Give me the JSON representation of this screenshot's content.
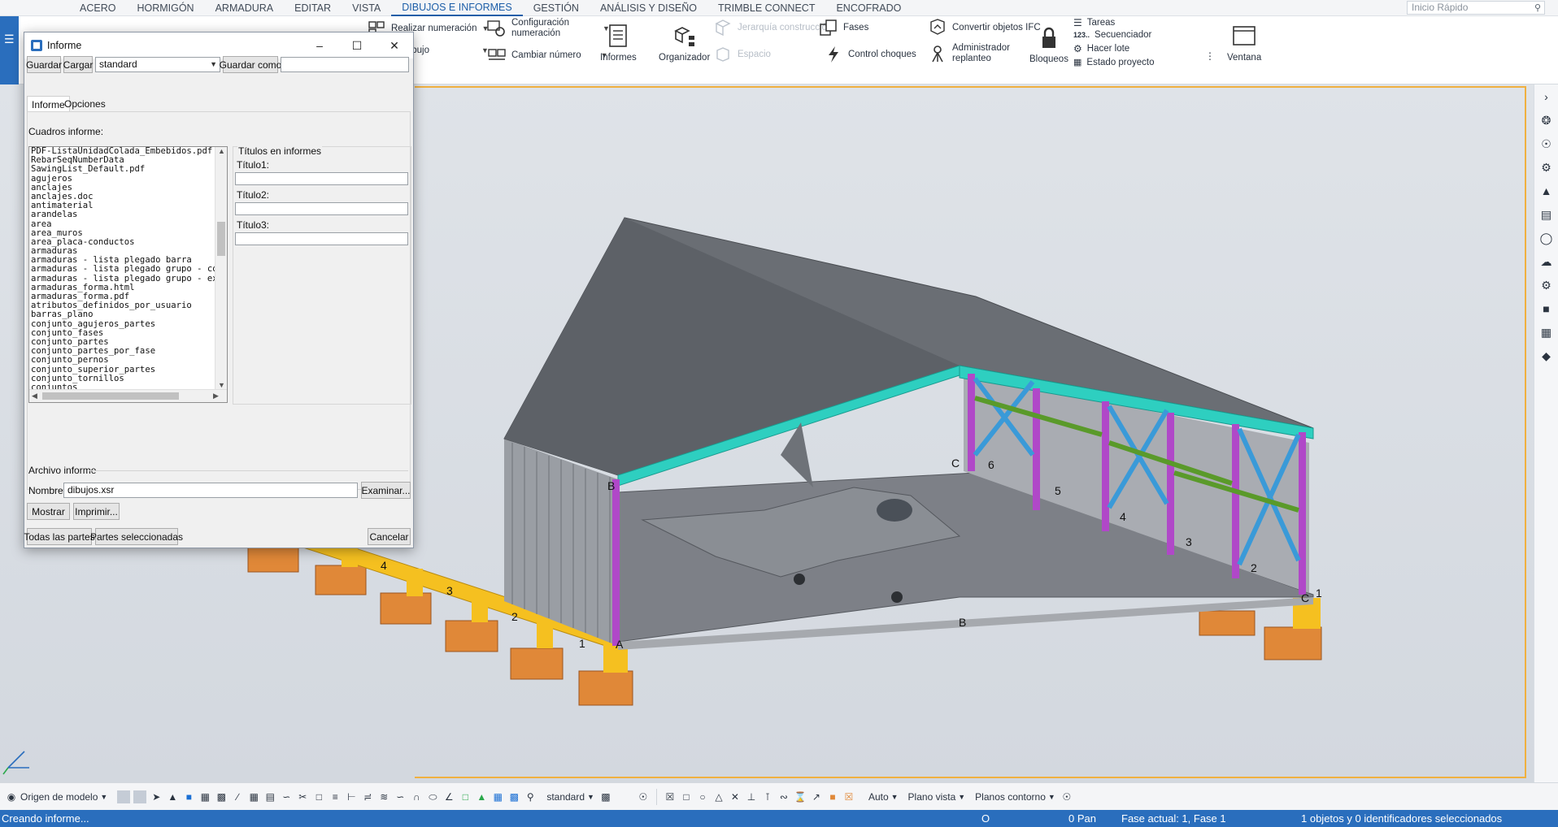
{
  "menubar": {
    "items": [
      "ACERO",
      "HORMIGÓN",
      "ARMADURA",
      "EDITAR",
      "VISTA",
      "DIBUJOS E INFORMES",
      "GESTIÓN",
      "ANÁLISIS Y DISEÑO",
      "TRIMBLE CONNECT",
      "ENCOFRADO"
    ],
    "active_index": 5,
    "quick_search_placeholder": "Inicio Rápido"
  },
  "ribbon": {
    "realizar_numeracion": "Realizar numeración",
    "multidibujo": "Multidibujo",
    "configuracion_numeracion": "Configuración numeración",
    "cambiar_numero": "Cambiar número",
    "informes": "Informes",
    "organizador": "Organizador",
    "jerarquia_construccion": "Jerarquía construcción",
    "espacio": "Espacio",
    "fases": "Fases",
    "control_choques": "Control choques",
    "convertir_ifc": "Convertir objetos IFC",
    "administrador_replanteo": "Administrador replanteo",
    "bloqueos": "Bloqueos",
    "tareas": "Tareas",
    "secuenciador": "Secuenciador",
    "hacer_lote": "Hacer lote",
    "estado_proyecto": "Estado proyecto",
    "ventana": "Ventana",
    "accent": "#2a6ebd"
  },
  "dialog": {
    "title": "Informe",
    "guardar": "Guardar",
    "cargar": "Cargar",
    "settings_value": "standard",
    "guardar_como": "Guardar como",
    "guardar_como_value": "",
    "tab_informe": "Informe",
    "tab_opciones": "Opciones",
    "cuadros_label": "Cuadros informe:",
    "reports": [
      "PDF-ListaUnidadColada_Embebidos.pdf",
      "RebarSeqNumberData",
      "SawingList_Default.pdf",
      "agujeros",
      "anclajes",
      "anclajes.doc",
      "antimaterial",
      "arandelas",
      "area",
      "area_muros",
      "area_placa-conductos",
      "armaduras",
      "armaduras - lista plegado barra",
      "armaduras - lista plegado grupo - compa",
      "armaduras - lista plegado grupo - exten",
      "armaduras_forma.html",
      "armaduras_forma.pdf",
      "atributos_definidos_por_usuario",
      "barras_plano",
      "conjunto_agujeros_partes",
      "conjunto_fases",
      "conjunto_partes",
      "conjunto_partes_por_fase",
      "conjunto_pernos",
      "conjunto_superior_partes",
      "conjunto_tornillos",
      "conjuntos"
    ],
    "titulos_group": "Títulos en informes",
    "titulo1_label": "Título1:",
    "titulo1_value": "",
    "titulo2_label": "Título2:",
    "titulo2_value": "",
    "titulo3_label": "Título3:",
    "titulo3_value": "",
    "archivo_label": "Archivo informe",
    "nombre_label": "Nombre:",
    "nombre_value": "dibujos.xsr",
    "examinar": "Examinar...",
    "mostrar": "Mostrar",
    "imprimir": "Imprimir...",
    "todas_partes": "Todas las partes",
    "partes_seleccionadas": "Partes seleccionadas",
    "cancelar": "Cancelar"
  },
  "viewport": {
    "grid_labels": {
      "near_numbers": [
        "4",
        "3",
        "2",
        "1"
      ],
      "far_numbers": [
        "6",
        "5",
        "4",
        "3",
        "2",
        "1"
      ],
      "A": "A",
      "B_left": "B",
      "B_front": "B",
      "C_back": "C",
      "C_right": "C"
    },
    "colors": {
      "frame": "#f0b040",
      "columns": "#b048c8",
      "beams": "#2ecfc0",
      "braces": "#3a9ad8",
      "girts": "#5a9a2a",
      "footings": "#e08838",
      "pedestals": "#f5c020",
      "roof": "#6a6e74"
    }
  },
  "bottombar": {
    "origen": "Origen de modelo",
    "standard": "standard",
    "auto": "Auto",
    "plano_vista": "Plano vista",
    "planos_contorno": "Planos contorno"
  },
  "statusbar": {
    "message": "Creando informe...",
    "o": "O",
    "pan": "0  Pan",
    "fase": "Fase actual: 1, Fase 1",
    "seleccion": "1 objetos y 0 identificadores seleccionados"
  }
}
